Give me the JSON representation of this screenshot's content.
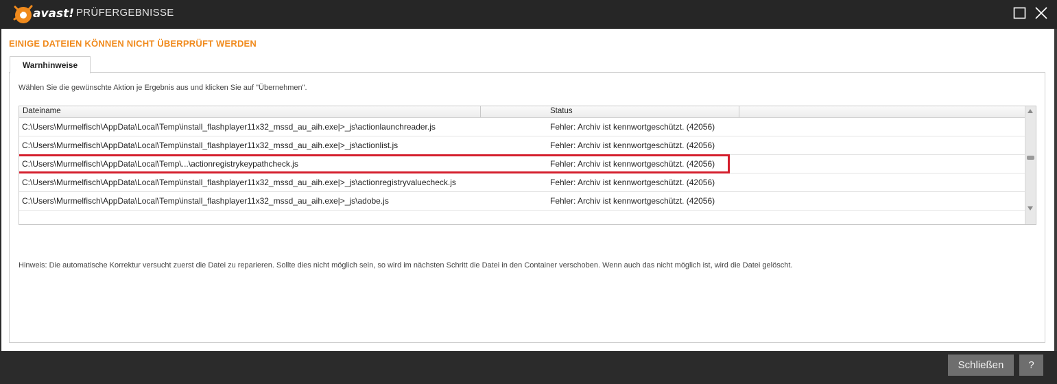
{
  "window": {
    "brand": "avast!",
    "title": "PRÜFERGEBNISSE"
  },
  "heading": "EINIGE DATEIEN KÖNNEN NICHT ÜBERPRÜFT WERDEN",
  "tabs": [
    {
      "label": "Warnhinweise",
      "active": true
    }
  ],
  "instruction": "Wählen Sie die gewünschte Aktion je Ergebnis aus und klicken Sie auf \"Übernehmen\".",
  "grid": {
    "columns": [
      "Dateiname",
      "Status"
    ],
    "rows": [
      {
        "file": "C:\\Users\\Murmelfisch\\AppData\\Local\\Temp\\install_flashplayer11x32_mssd_au_aih.exe|>_js\\actionlaunchreader.js",
        "status": "Fehler: Archiv ist kennwortgeschützt. (42056)"
      },
      {
        "file": "C:\\Users\\Murmelfisch\\AppData\\Local\\Temp\\install_flashplayer11x32_mssd_au_aih.exe|>_js\\actionlist.js",
        "status": "Fehler: Archiv ist kennwortgeschützt. (42056)"
      },
      {
        "file": "C:\\Users\\Murmelfisch\\AppData\\Local\\Temp\\...\\actionregistrykeypathcheck.js",
        "status": "Fehler: Archiv ist kennwortgeschützt. (42056)",
        "highlighted": true
      },
      {
        "file": "C:\\Users\\Murmelfisch\\AppData\\Local\\Temp\\install_flashplayer11x32_mssd_au_aih.exe|>_js\\actionregistryvaluecheck.js",
        "status": "Fehler: Archiv ist kennwortgeschützt. (42056)"
      },
      {
        "file": "C:\\Users\\Murmelfisch\\AppData\\Local\\Temp\\install_flashplayer11x32_mssd_au_aih.exe|>_js\\adobe.js",
        "status": "Fehler: Archiv ist kennwortgeschützt. (42056)"
      }
    ]
  },
  "hint": "Hinweis: Die automatische Korrektur versucht zuerst die Datei zu reparieren. Sollte dies nicht möglich sein, so wird im nächsten Schritt die Datei in den Container verschoben. Wenn auch das nicht möglich ist, wird die Datei gelöscht.",
  "footer": {
    "close_label": "Schließen",
    "help_label": "?"
  },
  "colors": {
    "accent": "#f08a1c",
    "highlight_border": "#d41e2c",
    "titlebar": "#262626",
    "button": "#6e6e6e"
  }
}
